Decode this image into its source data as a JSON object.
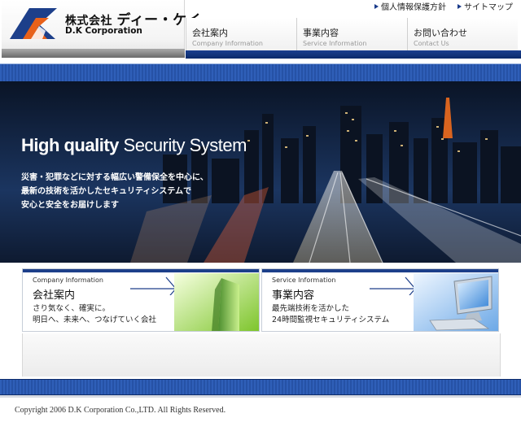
{
  "header": {
    "company_jp_prefix": "株式会社",
    "company_jp_brand": "ディー・ケイ",
    "company_en": "D.K Corporation",
    "top_links": [
      {
        "label": "個人情報保護方針",
        "icon": "arrow-right-icon"
      },
      {
        "label": "サイトマップ",
        "icon": "arrow-right-icon"
      }
    ],
    "nav": [
      {
        "jp": "会社案内",
        "en": "Company Information"
      },
      {
        "jp": "事業内容",
        "en": "Service Information"
      },
      {
        "jp": "お問い合わせ",
        "en": "Contact Us"
      }
    ]
  },
  "hero": {
    "title_bold": "High quality",
    "title_rest": "Security System",
    "text_lines": [
      "災害・犯罪などに対する幅広い警備保全を中心に、",
      "最新の技術を活かしたセキュリティシステムで",
      "安心と安全をお届けします"
    ]
  },
  "panels": [
    {
      "en": "Company Information",
      "jp": "会社案内",
      "desc_lines": [
        "さり気なく、確実に。",
        "明日へ、未来へ、つなげていく会社"
      ],
      "image": "building-image"
    },
    {
      "en": "Service Information",
      "jp": "事業内容",
      "desc_lines": [
        "最先端技術を活かした",
        "24時間監視セキュリティシステム"
      ],
      "image": "computer-monitor-image"
    }
  ],
  "footer": {
    "copyright": "Copyright 2006 D.K Corporation Co.,LTD. All Rights Reserved."
  },
  "colors": {
    "brand_blue": "#1d3f8a",
    "accent_orange": "#e8611a",
    "band_blue": "#2f5fb8"
  }
}
